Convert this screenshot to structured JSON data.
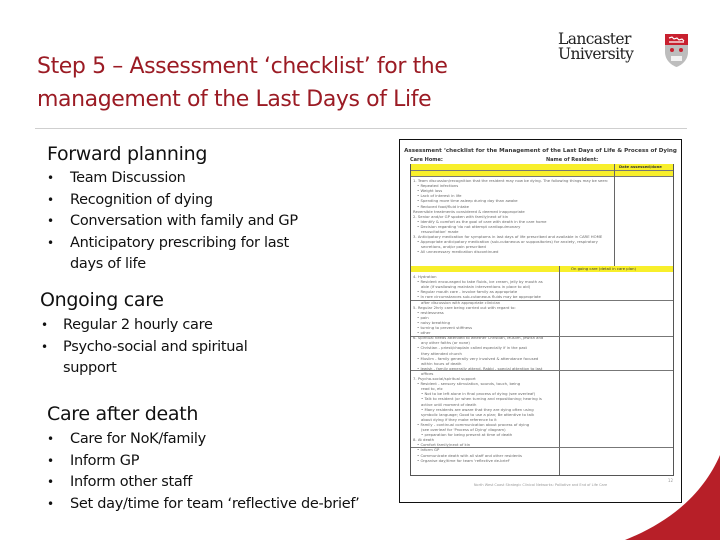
{
  "slide": {
    "title_line1": "Step 5 – Assessment ‘checklist’ for the",
    "title_line2": "management of the Last Days of Life",
    "accent_color": "#9b1b24"
  },
  "logo": {
    "line1": "Lancaster",
    "line2": "University",
    "icon": "university-crest-icon"
  },
  "sections": [
    {
      "heading": "Forward planning",
      "items": [
        "Team Discussion",
        "Recognition of dying",
        "Conversation with family and GP",
        "Anticipatory prescribing for last days of life"
      ]
    },
    {
      "heading": "Ongoing care",
      "items": [
        "Regular 2 hourly care",
        "Psycho-social and spiritual support"
      ]
    },
    {
      "heading": "Care after death",
      "items": [
        "Care for NoK/family",
        "Inform GP",
        "Inform other staff",
        "Set day/time for team ‘reflective de-brief’"
      ]
    }
  ],
  "document": {
    "title": "Assessment ‘checklist for the Management of the Last Days of Life & Process of Dying",
    "care_home_label": "Care Home:",
    "resident_label": "Name of Resident:",
    "date_header": "Date assessed/done",
    "ongoing_header": "On going care (detail in care plan)",
    "lines_top": [
      "1. Team discussion/recognition that the resident may now be dying. The following things may be seen:",
      "• Repeated infections",
      "• Weight loss",
      "• Lack of interest in life",
      "• Spending more time asleep during day than awake",
      "• Reduced food/fluid intake",
      "Reversible treatments considered & deemed inappropriate",
      "2. Senior and/or GP spoken with family/next of kin",
      "• Identify & comfort as the goal of care with death in the care home",
      "• Decision regarding 'do not attempt cardiopulmonary",
      "  resuscitation' made",
      "3. Anticipatory medication for symptoms in last days of life prescribed and available in CARE HOME",
      "• Appropriate anticipatory medication (sub-cutaneous or suppositories) for anxiety, respiratory",
      "  secretions, and/or pain prescribed",
      "• All unnecessary medication discontinued"
    ],
    "lines_bottom": [
      "4. Hydration",
      "• Resident encouraged to take fluids, ice cream, jelly by mouth as",
      "  able (if swallowing maintain interventions in place to aid)",
      "• Regular mouth care - involve family as appropriate",
      "• In rare circumstances sub-cutaneous fluids may be appropriate",
      "  after discussion with appropriate clinician",
      "5. Regular 2hrly care being carried out with regard to:",
      "• restlessness",
      "• pain",
      "• noisy breathing",
      "• turning to prevent stiffness",
      "• other",
      "6. Spiritual needs attended to whether Christian, Muslim, Jewish and",
      "  any other faiths (or none)",
      "• Christian - priest/chaplain called especially if in the past",
      "  they attended church",
      "• Muslim - family generally very involved & attendance focused",
      "  within hours of death",
      "• Jewish - family generally attend. Rabbi - special attention to last",
      "  offices",
      "7. Psycho-social/spiritual support",
      "• Resident - sensory stimulation, sounds, touch, being",
      "  read to, etc",
      "  • Not to be left alone in final process of dying (see overleaf)",
      "  • Talk to resident (or when turning and repositioning; hearing is",
      "    active until moment of death",
      "  • Many residents are aware that they are dying often using",
      "    symbolic language; Good to use a plan; Be attentive to talk",
      "    about dying if they make reference to it",
      "• Family - continual communication about process of dying",
      "  (see overleaf for 'Process of Dying' diagram)",
      "  • preparation for being present at time of death",
      "8. At death",
      "• Comfort family/next of kin",
      "• Inform GP",
      "• Communicate death with all staff and other residents",
      "• Organise day/time for team 'reflective de-brief'"
    ],
    "footer": "North West Coast Strategic Clinical Networks: Palliative and End of Life Care",
    "page_number": "12"
  }
}
